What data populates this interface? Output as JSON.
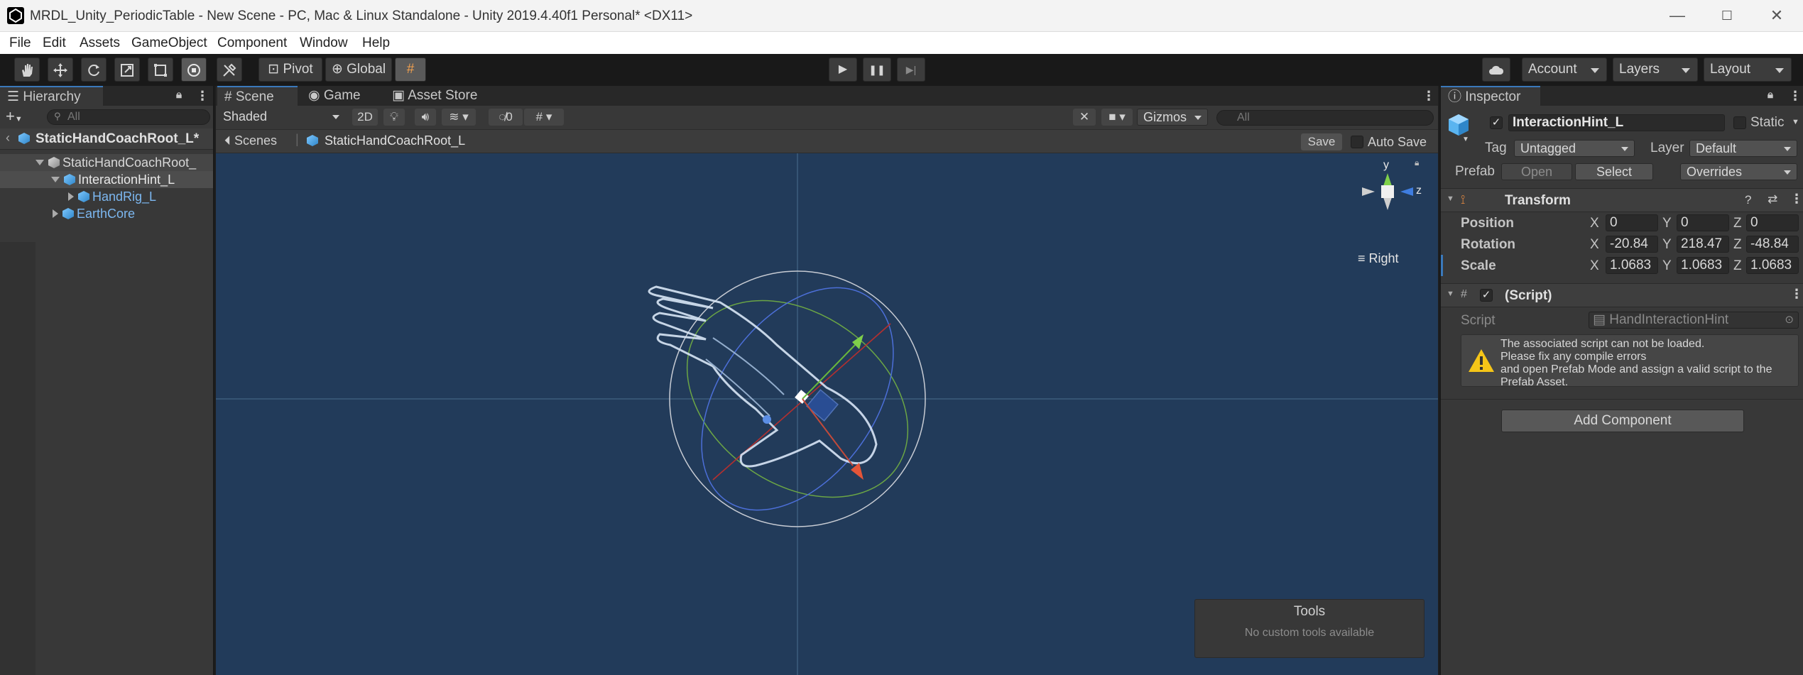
{
  "window": {
    "title": "MRDL_Unity_PeriodicTable - New Scene - PC, Mac & Linux Standalone - Unity 2019.4.40f1 Personal* <DX11>",
    "controls": {
      "minimize": "—",
      "maximize": "☐",
      "close": "✕"
    }
  },
  "menu": [
    "File",
    "Edit",
    "Assets",
    "GameObject",
    "Component",
    "Window",
    "Help"
  ],
  "toolbar": {
    "tools": [
      "hand-tool",
      "move-tool",
      "rotate-tool",
      "scale-tool",
      "rect-tool",
      "transform-tool",
      "custom-tool"
    ],
    "pivot_label": "Pivot",
    "global_label": "Global",
    "play_icon": "▶",
    "pause_icon": "❚❚",
    "step_icon": "▶|",
    "account_label": "Account",
    "layers_label": "Layers",
    "layout_label": "Layout"
  },
  "hierarchy": {
    "tab_label": "Hierarchy",
    "add_label": "+",
    "search_placeholder": "All",
    "root_label": "StaticHandCoachRoot_L*",
    "items": [
      {
        "label": "StaticHandCoachRoot_"
      },
      {
        "label": "InteractionHint_L"
      },
      {
        "label": "HandRig_L"
      },
      {
        "label": "EarthCore"
      }
    ]
  },
  "scene": {
    "tabs": [
      {
        "label": "Scene",
        "icon": "#"
      },
      {
        "label": "Game",
        "icon": "◉"
      },
      {
        "label": "Asset Store",
        "icon": "▣"
      }
    ],
    "shading_label": "Shaded",
    "twod_label": "2D",
    "hidden_count": "0",
    "gizmos_label": "Gizmos",
    "search_placeholder": "All",
    "crumb_scenes": "Scenes",
    "crumb_prefab": "StaticHandCoachRoot_L",
    "save_label": "Save",
    "autosave_label": "Auto Save",
    "orientation_label": "Right",
    "gizmo_axes": {
      "y": "y",
      "z": "z"
    },
    "tools_overlay": {
      "title": "Tools",
      "message": "No custom tools available"
    }
  },
  "inspector": {
    "tab_label": "Inspector",
    "object_name": "InteractionHint_L",
    "static_label": "Static",
    "tag_label": "Tag",
    "tag_value": "Untagged",
    "layer_label": "Layer",
    "layer_value": "Default",
    "prefab_label": "Prefab",
    "prefab_open": "Open",
    "prefab_select": "Select",
    "prefab_overrides": "Overrides",
    "transform": {
      "title": "Transform",
      "position_label": "Position",
      "rotation_label": "Rotation",
      "scale_label": "Scale",
      "axis_x": "X",
      "axis_y": "Y",
      "axis_z": "Z",
      "position": {
        "x": "0",
        "y": "0",
        "z": "0"
      },
      "rotation": {
        "x": "-20.84",
        "y": "218.47",
        "z": "-48.84"
      },
      "scale": {
        "x": "1.0683",
        "y": "1.0683",
        "z": "1.0683"
      }
    },
    "script": {
      "title": "(Script)",
      "script_label": "Script",
      "script_value": "HandInteractionHint",
      "warning_lines": [
        "The associated script can not be loaded.",
        "Please fix any compile errors",
        "and open Prefab Mode and assign a valid script to the",
        "Prefab Asset."
      ]
    },
    "add_component_label": "Add Component"
  }
}
